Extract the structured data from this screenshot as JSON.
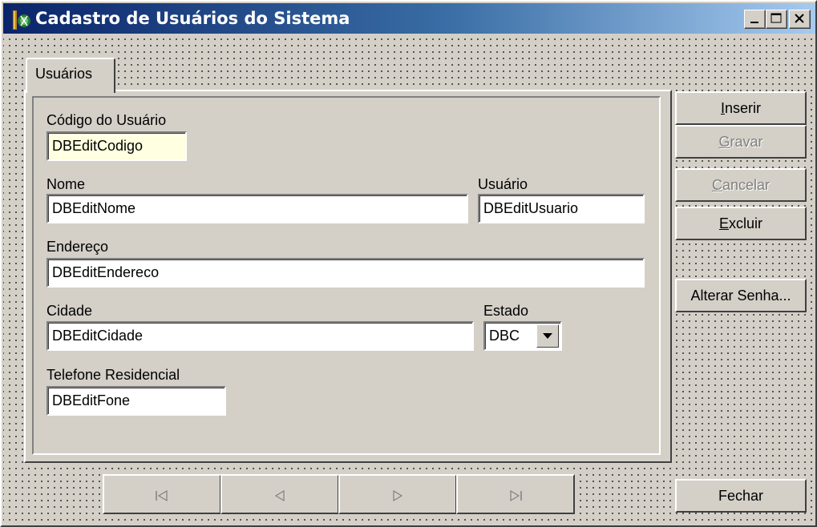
{
  "window": {
    "title": "Cadastro de Usuários do Sistema"
  },
  "tabs": [
    {
      "label": "Usuários",
      "selected": true
    }
  ],
  "form": {
    "codigo": {
      "label": "Código do Usuário",
      "value": "DBEditCodigo"
    },
    "nome": {
      "label": "Nome",
      "value": "DBEditNome"
    },
    "usuario": {
      "label": "Usuário",
      "value": "DBEditUsuario"
    },
    "endereco": {
      "label": "Endereço",
      "value": "DBEditEndereco"
    },
    "cidade": {
      "label": "Cidade",
      "value": "DBEditCidade"
    },
    "estado": {
      "label": "Estado",
      "value": "DBC"
    },
    "telefone": {
      "label": "Telefone Residencial",
      "value": "DBEditFone"
    }
  },
  "buttons": {
    "inserir": {
      "pre": "",
      "accel": "I",
      "post": "nserir",
      "enabled": true
    },
    "gravar": {
      "pre": "",
      "accel": "G",
      "post": "ravar",
      "enabled": false
    },
    "cancelar": {
      "pre": "",
      "accel": "C",
      "post": "ancelar",
      "enabled": false
    },
    "excluir": {
      "pre": "",
      "accel": "E",
      "post": "xcluir",
      "enabled": true
    },
    "alterar_senha": {
      "label": "Alterar Senha...",
      "enabled": true
    },
    "fechar": {
      "label": "Fechar",
      "enabled": true
    }
  },
  "navigator": {
    "buttons": [
      {
        "icon": "first-record-icon",
        "enabled": false
      },
      {
        "icon": "prior-record-icon",
        "enabled": false
      },
      {
        "icon": "next-record-icon",
        "enabled": false
      },
      {
        "icon": "last-record-icon",
        "enabled": false
      }
    ]
  },
  "colors": {
    "face": "#d4d0c8",
    "title_start": "#0a246a",
    "title_end": "#a6caf0",
    "edit_highlight": "#ffffe1",
    "disabled_text": "#808080"
  }
}
